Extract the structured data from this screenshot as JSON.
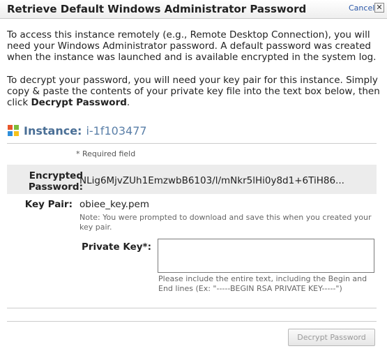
{
  "dialog": {
    "title": "Retrieve Default Windows Administrator Password",
    "cancel_label": "Cancel",
    "close_glyph": "✕"
  },
  "intro": {
    "paragraph1": "To access this instance remotely (e.g., Remote Desktop Connection), you will need your Windows Administrator password. A default password was created when the instance was launched and is available encrypted in the system log.",
    "paragraph2_prefix": "To decrypt your password, you will need your key pair for this instance. Simply copy & paste the contents of your private key file into the text box below, then click ",
    "paragraph2_bold": "Decrypt Password",
    "paragraph2_suffix": "."
  },
  "instance": {
    "icon": "windows-icon",
    "label": "Instance:",
    "id": "i-1f103477"
  },
  "form": {
    "required_note": "* Required field",
    "encrypted_password": {
      "label_line1": "Encrypted",
      "label_line2": "Password:",
      "value": "NLig6MjvZUh1EmzwbB6103/l/mNkr5lHi0y8d1+6TiH86..."
    },
    "key_pair": {
      "label": "Key Pair:",
      "value": "obiee_key.pem",
      "note": "Note: You were prompted to download and save this when you created your key pair."
    },
    "private_key": {
      "label": "Private Key*:",
      "value": "",
      "note": "Please include the entire text, including the Begin and End lines (Ex: \"-----BEGIN RSA PRIVATE KEY-----\")"
    }
  },
  "footer": {
    "decrypt_button_label": "Decrypt Password"
  },
  "colors": {
    "instance_label": "#4a6f96",
    "link": "#2a57a8",
    "encrypted_row_bg": "#ececec"
  }
}
